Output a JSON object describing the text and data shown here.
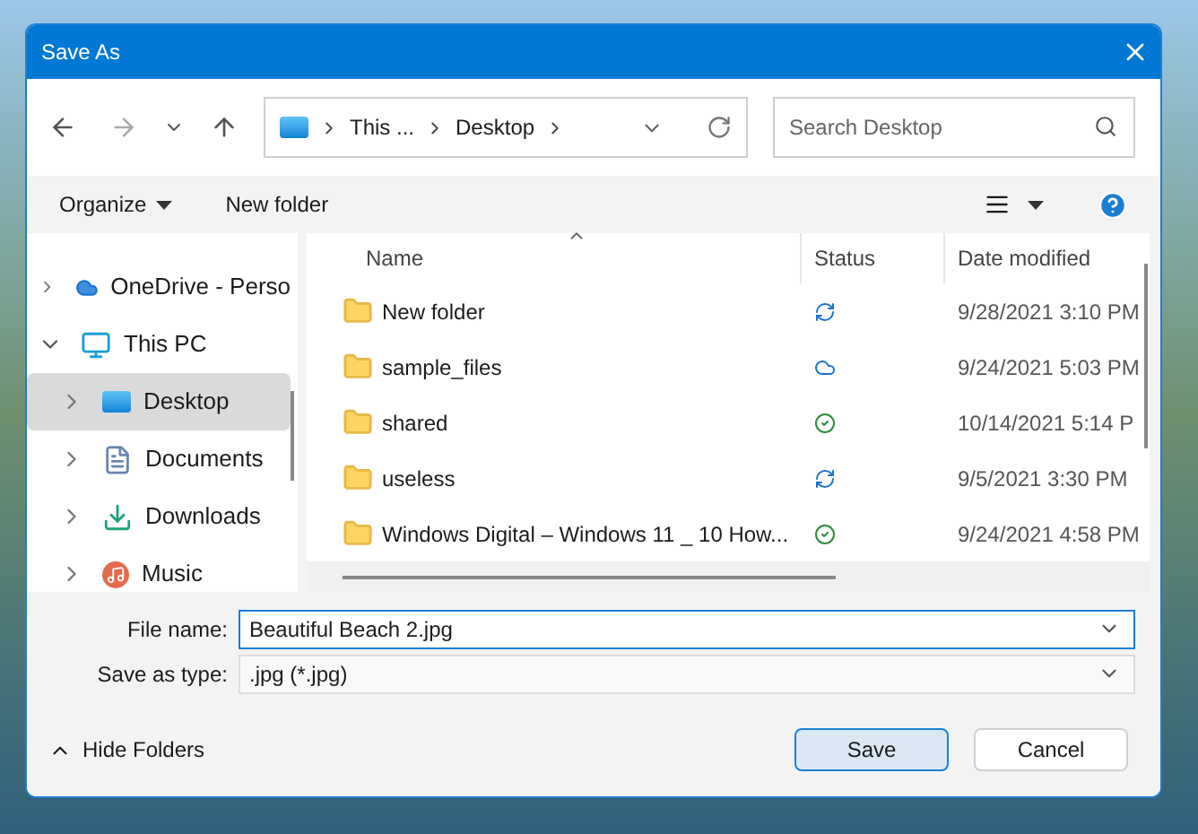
{
  "window": {
    "title": "Save As"
  },
  "address_bar": {
    "segments": [
      "This ...",
      "Desktop"
    ]
  },
  "search": {
    "placeholder": "Search Desktop"
  },
  "command_bar": {
    "items": [
      "Organize",
      "New folder"
    ]
  },
  "sidebar": {
    "items": [
      {
        "label": "OneDrive - Perso",
        "kind": "cloud",
        "expanded": false,
        "selected": false
      },
      {
        "label": "This PC",
        "kind": "pc",
        "expanded": true,
        "selected": false,
        "children": [
          {
            "label": "Desktop",
            "kind": "desktop",
            "expanded": false,
            "selected": true
          },
          {
            "label": "Documents",
            "kind": "documents",
            "expanded": false,
            "selected": false
          },
          {
            "label": "Downloads",
            "kind": "downloads",
            "expanded": false,
            "selected": false
          },
          {
            "label": "Music",
            "kind": "music",
            "expanded": false,
            "selected": false
          }
        ]
      }
    ]
  },
  "table": {
    "columns": [
      "Name",
      "Status",
      "Date modified"
    ],
    "rows": [
      {
        "name": "New folder",
        "kind": "sync",
        "date": "9/28/2021 3:10 PM"
      },
      {
        "name": "sample_files",
        "kind": "cloud",
        "date": "9/24/2021 5:03 PM"
      },
      {
        "name": "shared",
        "kind": "available",
        "date": "10/14/2021 5:14 P"
      },
      {
        "name": "useless",
        "kind": "sync",
        "date": "9/5/2021 3:30 PM"
      },
      {
        "name": "Windows Digital – Windows 11 _ 10 How...",
        "kind": "available",
        "date": "9/24/2021 4:58 PM"
      }
    ]
  },
  "form": {
    "file_name": {
      "label": "File name:",
      "value": "Beautiful Beach 2.jpg"
    },
    "save_as_type": {
      "label": "Save as type:",
      "value": ".jpg (*.jpg)"
    }
  },
  "footer": {
    "hide_folders": "Hide Folders",
    "buttons": [
      {
        "label": "Save",
        "default": true
      },
      {
        "label": "Cancel",
        "default": false
      }
    ]
  }
}
